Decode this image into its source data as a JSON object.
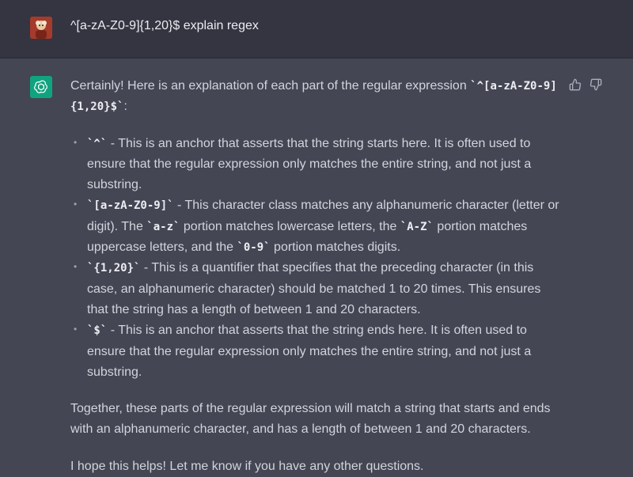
{
  "user": {
    "message": "^[a-zA-Z0-9]{1,20}$ explain regex"
  },
  "assistant": {
    "intro_text": "Certainly! Here is an explanation of each part of the regular expression ",
    "intro_code": "`^[a-zA-Z0-9]{1,20}$`",
    "intro_end": ":",
    "bullets": [
      {
        "code": "`^`",
        "text": " - This is an anchor that asserts that the string starts here. It is often used to ensure that the regular expression only matches the entire string, and not just a substring."
      },
      {
        "code": "`[a-zA-Z0-9]`",
        "text1": " - This character class matches any alphanumeric character (letter or digit). The ",
        "code2": "`a-z`",
        "text2": " portion matches lowercase letters, the ",
        "code3": "`A-Z`",
        "text3": " portion matches uppercase letters, and the ",
        "code4": "`0-9`",
        "text4": " portion matches digits."
      },
      {
        "code": "`{1,20}`",
        "text": " - This is a quantifier that specifies that the preceding character (in this case, an alphanumeric character) should be matched 1 to 20 times. This ensures that the string has a length of between 1 and 20 characters."
      },
      {
        "code": "`$`",
        "text": " - This is an anchor that asserts that the string ends here. It is often used to ensure that the regular expression only matches the entire string, and not just a substring."
      }
    ],
    "together": "Together, these parts of the regular expression will match a string that starts and ends with an alphanumeric character, and has a length of between 1 and 20 characters.",
    "closing": "I hope this helps! Let me know if you have any other questions."
  },
  "icons": {
    "user_avatar": "user-avatar-icon",
    "bot_avatar": "openai-logo-icon",
    "thumbs_up": "thumbs-up-icon",
    "thumbs_down": "thumbs-down-icon"
  },
  "colors": {
    "user_bg": "#343541",
    "assistant_bg": "#444654",
    "bot_avatar_bg": "#10a37f",
    "text": "#d1d5db"
  }
}
